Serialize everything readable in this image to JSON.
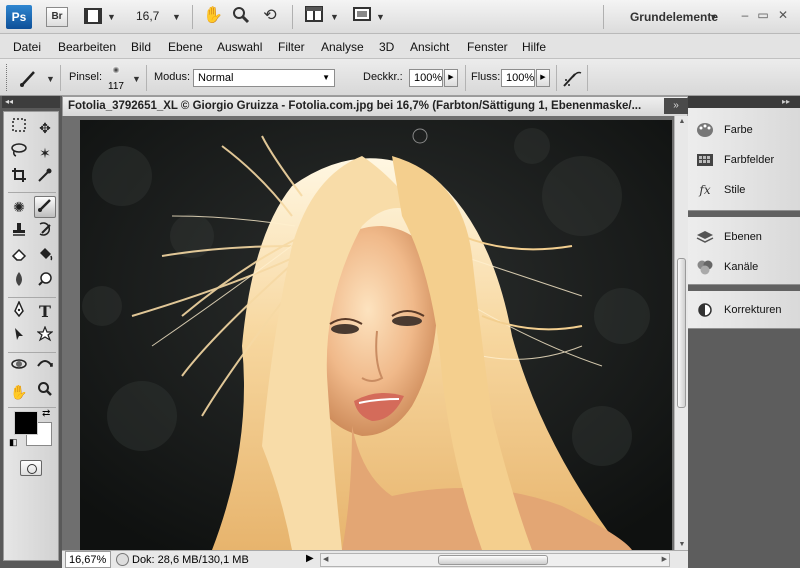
{
  "appbar": {
    "logo": "Ps",
    "bridge": "Br",
    "zoom": "16,7",
    "workspace": "Grundelemente",
    "icons": [
      "film-icon",
      "hand-icon",
      "zoom-icon",
      "rotate-view-icon",
      "arrange-documents-icon",
      "screen-mode-icon"
    ],
    "window_controls": [
      "minimize",
      "restore",
      "close"
    ]
  },
  "menu": [
    "Datei",
    "Bearbeiten",
    "Bild",
    "Ebene",
    "Auswahl",
    "Filter",
    "Analyse",
    "3D",
    "Ansicht",
    "Fenster",
    "Hilfe"
  ],
  "options": {
    "brush_label": "Pinsel:",
    "brush_size": "117",
    "mode_label": "Modus:",
    "mode_value": "Normal",
    "opacity_label": "Deckkr.:",
    "opacity_value": "100%",
    "flow_label": "Fluss:",
    "flow_value": "100%"
  },
  "document": {
    "title": "Fotolia_3792651_XL © Giorgio Gruizza - Fotolia.com.jpg bei 16,7% (Farbton/Sättigung 1, Ebenenmaske/...",
    "close": "×",
    "expand": "»"
  },
  "status": {
    "zoom": "16,67%",
    "info": "Dok: 28,6 MB/130,1 MB"
  },
  "tools": {
    "foreground": "#000000",
    "background": "#ffffff",
    "items": [
      "marquee",
      "move",
      "lasso",
      "magic-wand",
      "crop",
      "eyedropper",
      "spot-heal",
      "brush",
      "clone-stamp",
      "history-brush",
      "eraser",
      "paint-bucket",
      "blur",
      "dodge",
      "pen",
      "type",
      "path-select",
      "shape",
      "3d-rotate",
      "3d-orbit",
      "hand",
      "zoom"
    ],
    "text_tool_label": "T"
  },
  "panels": {
    "group1": [
      {
        "label": "Farbe",
        "icon": "color-palette-icon"
      },
      {
        "label": "Farbfelder",
        "icon": "swatches-icon"
      },
      {
        "label": "Stile",
        "icon": "styles-icon"
      }
    ],
    "group2": [
      {
        "label": "Ebenen",
        "icon": "layers-icon"
      },
      {
        "label": "Kanäle",
        "icon": "channels-icon"
      }
    ],
    "group3": [
      {
        "label": "Korrekturen",
        "icon": "adjustments-icon"
      }
    ],
    "collapse_left": "◂◂",
    "collapse_right": "▸▸"
  }
}
